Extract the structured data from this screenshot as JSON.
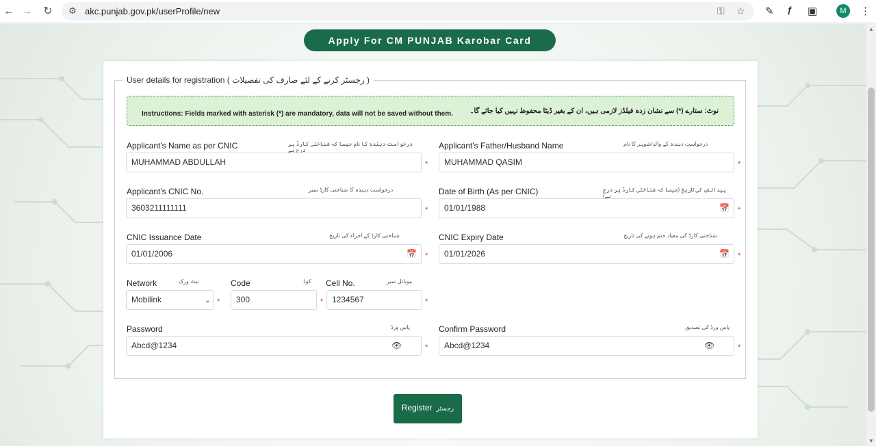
{
  "browser": {
    "url": "akc.punjab.gov.pk/userProfile/new",
    "profile_initial": "M",
    "icons": {
      "back": "arrow-left-icon",
      "forward": "arrow-right-icon",
      "reload": "reload-icon",
      "site": "tune-icon",
      "key": "key-icon",
      "star": "star-icon",
      "eyedropper": "eyedropper-icon",
      "font": "font-icon",
      "extensions": "puzzle-icon",
      "menu": "kebab-menu-icon"
    }
  },
  "page": {
    "title": "Apply For CM PUNJAB Karobar Card",
    "legend": "User details for registration ( رجسٹر کرنے کے لئے صارف کی تفصیلات )",
    "instructions_en": "Instructions: Fields marked with asterisk (*) are mandatory, data will not be saved without them.",
    "instructions_ur": "نوٹ: ستارے (*) سے نشان زدہ فیلڈز لازمی ہیں، ان کے بغیر ڈیٹا محفوظ نہیں کیا جائے گا۔",
    "required_mark": "*",
    "accent_color": "#1a6b4a"
  },
  "form": {
    "name": {
      "label": "Applicant's Name as per CNIC",
      "urdu": "درخواست دہندہ کا نام جیسا کہ شناختی کارڈ پر درج ہے",
      "value": "MUHAMMAD ABDULLAH"
    },
    "father": {
      "label": "Applicant's Father/Husband Name",
      "urdu": "درخواست دہندہ کے والد/شوہر کا نام",
      "value": "MUHAMMAD QASIM"
    },
    "cnic": {
      "label": "Applicant's CNIC No.",
      "urdu": "درخواست دہندہ کا شناختی کارڈ نمبر",
      "value": "3603211111111"
    },
    "dob": {
      "label": "Date of Birth (As per CNIC)",
      "urdu": "پیدائش کی تاریخ (جیسا کہ شناختی کارڈ پر درج ہے)",
      "value": "01/01/1988"
    },
    "issuance": {
      "label": "CNIC Issuance Date",
      "urdu": "شناختی کارڈ کے اجراء کی تاریخ",
      "value": "01/01/2006"
    },
    "expiry": {
      "label": "CNIC Expiry Date",
      "urdu": "شناختی کارڈ کی معیاد ختم ہونے کی تاریخ",
      "value": "01/01/2026"
    },
    "network": {
      "label": "Network",
      "urdu": "نیٹ ورک",
      "value": "Mobilink"
    },
    "code": {
      "label": "Code",
      "urdu": "کوڈ",
      "value": "300"
    },
    "cell": {
      "label": "Cell No.",
      "urdu": "موبائل نمبر",
      "value": "1234567"
    },
    "password": {
      "label": "Password",
      "urdu": "پاس ورڈ",
      "value": "Abcd@1234"
    },
    "confirm": {
      "label": "Confirm Password",
      "urdu": "پاس ورڈ کی تصدیق",
      "value": "Abcd@1234"
    }
  },
  "register": {
    "label": "Register",
    "urdu": "رجسٹر"
  }
}
